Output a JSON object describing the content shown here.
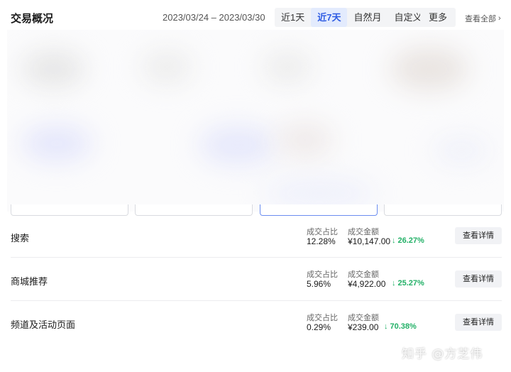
{
  "header": {
    "title": "交易概况",
    "date_range": "2023/03/24 – 2023/03/30",
    "periods": [
      "近1天",
      "近7天",
      "自然月",
      "自定义"
    ],
    "active_period": "近7天",
    "more_label": "更多",
    "view_all_label": "查看全部"
  },
  "rows": [
    {
      "name": "搜索",
      "share_label": "成交占比",
      "share_value": "12.28%",
      "amount_label": "成交金额",
      "amount_value": "¥10,147.00",
      "change": "26.27%",
      "detail_label": "查看详情"
    },
    {
      "name": "商城推荐",
      "share_label": "成交占比",
      "share_value": "5.96%",
      "amount_label": "成交金额",
      "amount_value": "¥4,922.00",
      "change": "25.27%",
      "detail_label": "查看详情"
    },
    {
      "name": "频道及活动页面",
      "share_label": "成交占比",
      "share_value": "0.29%",
      "amount_label": "成交金额",
      "amount_value": "¥239.00",
      "change": "70.38%",
      "detail_label": "查看详情"
    }
  ],
  "watermark": "知乎 @方芝伟",
  "colors": {
    "accent": "#2d5be3",
    "positive": "#21b066",
    "active_bg": "#e3ebfd"
  },
  "icons": {
    "change": "arrow-down-icon",
    "view_all": "chevron-right-icon"
  }
}
